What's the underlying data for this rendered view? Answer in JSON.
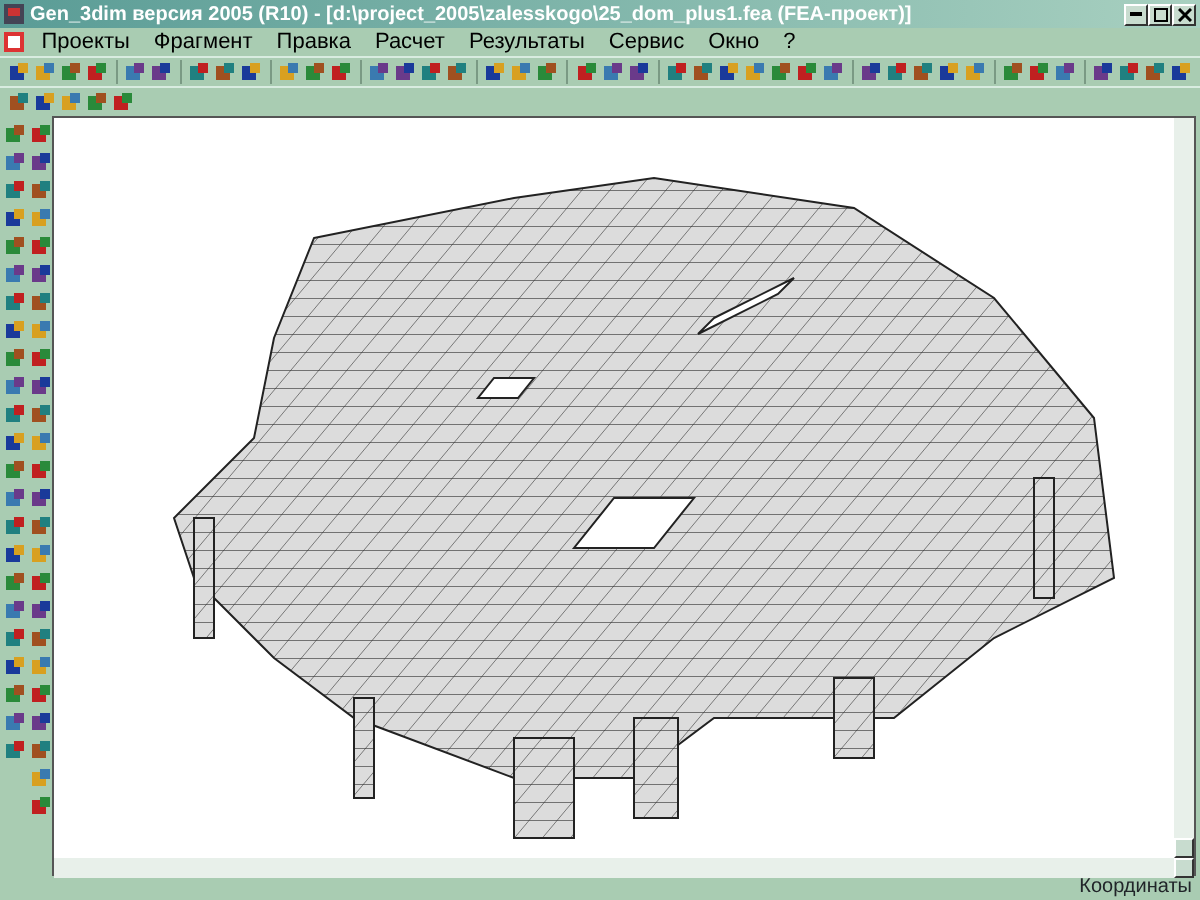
{
  "window": {
    "title": "Gen_3dim версия 2005 (R10) - [d:\\project_2005\\zalesskogo\\25_dom_plus1.fea  (FEA-проект)]"
  },
  "menu": [
    "Проекты",
    "Фрагмент",
    "Правка",
    "Расчет",
    "Результаты",
    "Сервис",
    "Окно",
    "?"
  ],
  "status_bar": {
    "text": "Координаты"
  }
}
